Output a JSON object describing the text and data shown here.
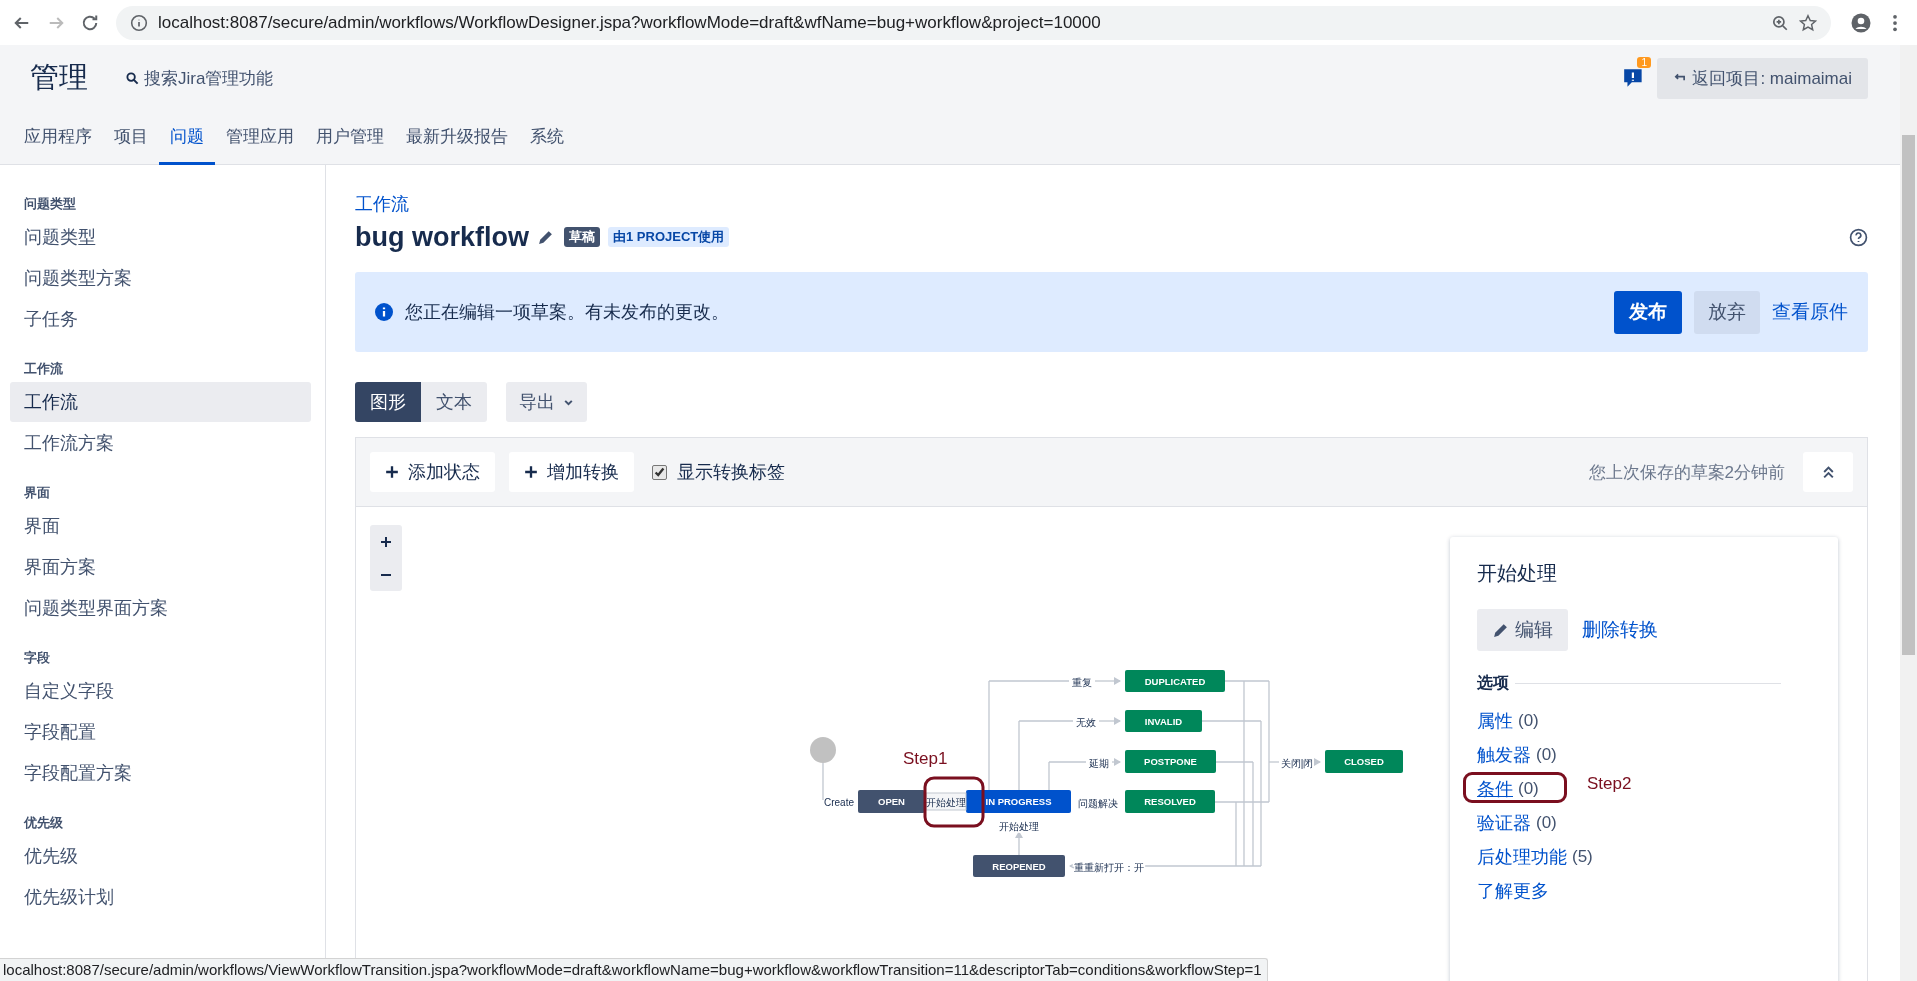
{
  "browser": {
    "url": "localhost:8087/secure/admin/workflows/WorkflowDesigner.jspa?workflowMode=draft&wfName=bug+workflow&project=10000"
  },
  "header": {
    "title": "管理",
    "search": "搜索Jira管理功能",
    "notification_count": "1",
    "back_button": "返回项目: maimaimai"
  },
  "nav_tabs": [
    {
      "label": "应用程序",
      "selected": false
    },
    {
      "label": "项目",
      "selected": false
    },
    {
      "label": "问题",
      "selected": true
    },
    {
      "label": "管理应用",
      "selected": false
    },
    {
      "label": "用户管理",
      "selected": false
    },
    {
      "label": "最新升级报告",
      "selected": false
    },
    {
      "label": "系统",
      "selected": false
    }
  ],
  "sidebar": [
    {
      "heading": "问题类型",
      "items": [
        {
          "label": "问题类型",
          "selected": false
        },
        {
          "label": "问题类型方案",
          "selected": false
        },
        {
          "label": "子任务",
          "selected": false
        }
      ]
    },
    {
      "heading": "工作流",
      "items": [
        {
          "label": "工作流",
          "selected": true
        },
        {
          "label": "工作流方案",
          "selected": false
        }
      ]
    },
    {
      "heading": "界面",
      "items": [
        {
          "label": "界面",
          "selected": false
        },
        {
          "label": "界面方案",
          "selected": false
        },
        {
          "label": "问题类型界面方案",
          "selected": false
        }
      ]
    },
    {
      "heading": "字段",
      "items": [
        {
          "label": "自定义字段",
          "selected": false
        },
        {
          "label": "字段配置",
          "selected": false
        },
        {
          "label": "字段配置方案",
          "selected": false
        }
      ]
    },
    {
      "heading": "优先级",
      "items": [
        {
          "label": "优先级",
          "selected": false
        },
        {
          "label": "优先级计划",
          "selected": false
        }
      ]
    }
  ],
  "breadcrumb": "工作流",
  "workflow": {
    "name": "bug workflow",
    "status_badge": "草稿",
    "usage_badge": "由1 PROJECT使用"
  },
  "draft_message": {
    "text": "您正在编辑一项草案。有未发布的更改。",
    "publish": "发布",
    "discard": "放弃",
    "view_original": "查看原件"
  },
  "view_tabs": [
    {
      "label": "图形",
      "selected": true
    },
    {
      "label": "文本",
      "selected": false
    }
  ],
  "export_button": "导出",
  "toolbar": {
    "add_status": "添加状态",
    "add_transition": "增加转换",
    "show_labels": {
      "label": "显示转换标签",
      "checked": true
    },
    "saved_note": "您上次保存的草案2分钟前"
  },
  "diagram": {
    "start_label": "Create",
    "statuses": [
      {
        "name": "OPEN",
        "color": "#42526e"
      },
      {
        "name": "IN PROGRESS",
        "color": "#0052cc"
      },
      {
        "name": "DUPLICATED",
        "color": "#00875a"
      },
      {
        "name": "INVALID",
        "color": "#00875a"
      },
      {
        "name": "POSTPONE",
        "color": "#00875a"
      },
      {
        "name": "RESOLVED",
        "color": "#00875a"
      },
      {
        "name": "CLOSED",
        "color": "#00875a"
      },
      {
        "name": "REOPENED",
        "color": "#42526e"
      }
    ],
    "transition_labels": [
      {
        "label": "开始处理",
        "selected": true
      },
      {
        "label": "开始处理",
        "selected": false
      },
      {
        "label": "重复",
        "selected": false
      },
      {
        "label": "无效",
        "selected": false
      },
      {
        "label": "延期",
        "selected": false
      },
      {
        "label": "问题解决",
        "selected": false
      },
      {
        "label": "关闭|闭",
        "selected": false
      },
      {
        "label": "重重新打开：开",
        "selected": false
      }
    ]
  },
  "transition_panel": {
    "title": "开始处理",
    "edit_button": "编辑",
    "delete_link": "删除转换",
    "options_heading": "选项",
    "options": [
      {
        "label": "属性",
        "count": "(0)"
      },
      {
        "label": "触发器",
        "count": "(0)"
      },
      {
        "label": "条件",
        "count": "(0)"
      },
      {
        "label": "验证器",
        "count": "(0)"
      },
      {
        "label": "后处理功能",
        "count": "(5)"
      }
    ],
    "learn_more": "了解更多"
  },
  "annotations": [
    {
      "text": "Step1"
    },
    {
      "text": "Step2"
    }
  ],
  "status_bar": "localhost:8087/secure/admin/workflows/ViewWorkflowTransition.jspa?workflowMode=draft&workflowName=bug+workflow&workflowTransition=11&descriptorTab=conditions&workflowStep=1"
}
